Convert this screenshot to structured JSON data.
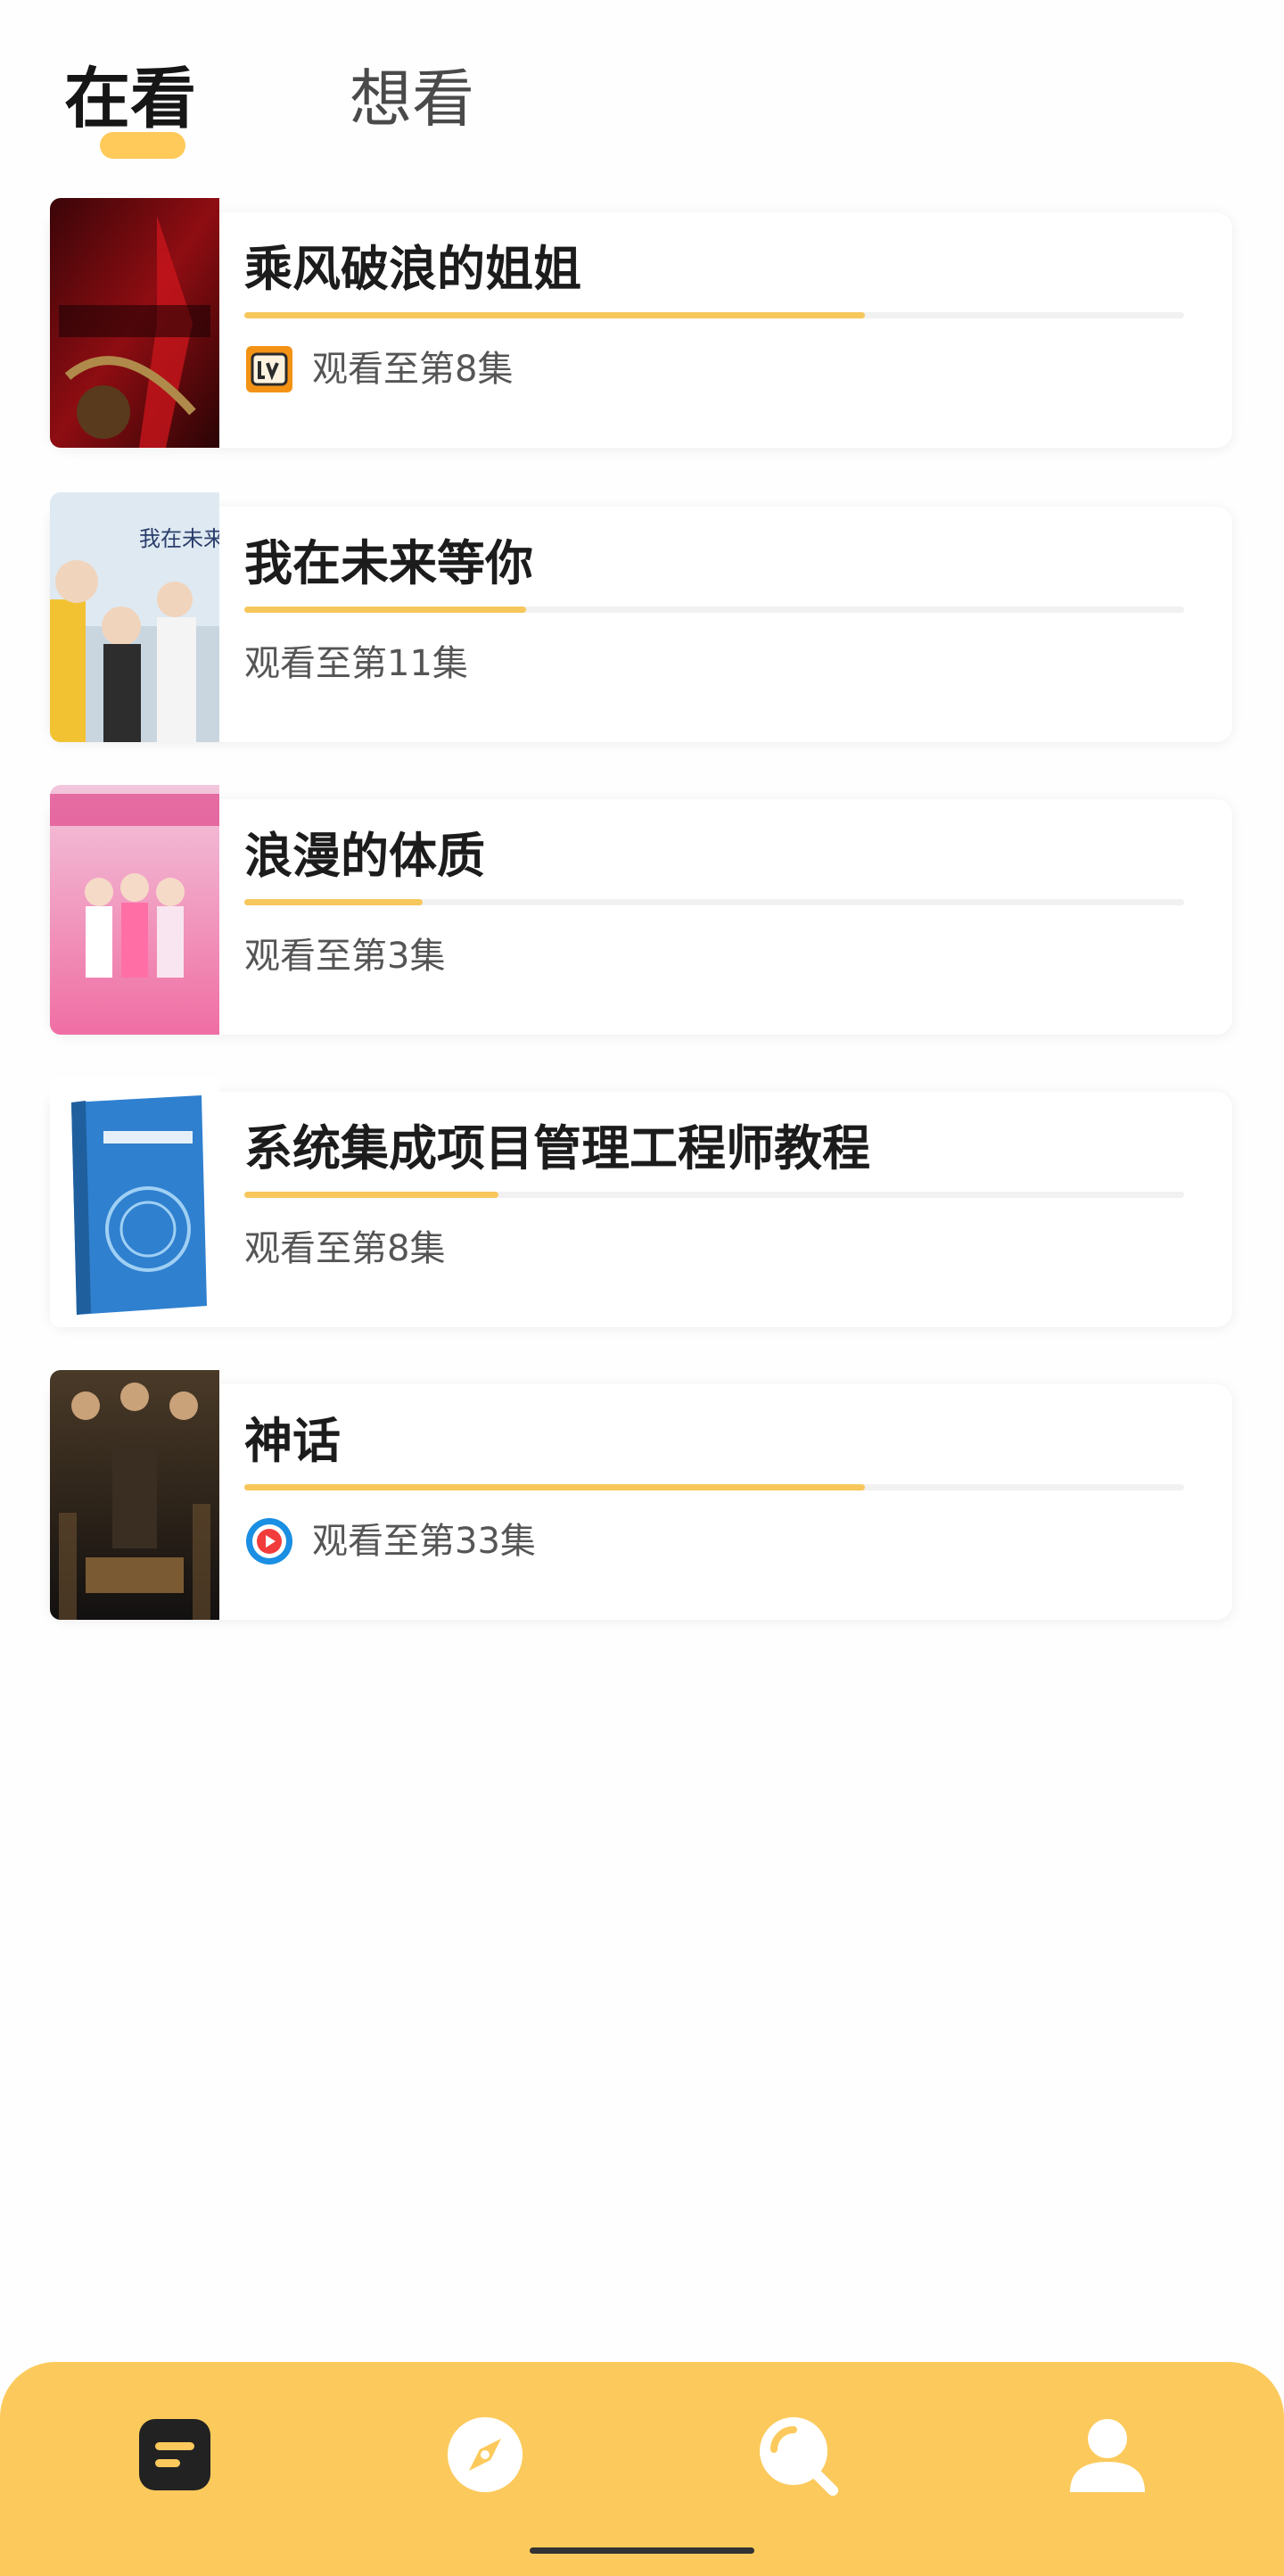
{
  "tabs": {
    "watching": "在看",
    "want_to_watch": "想看"
  },
  "items": [
    {
      "title": "乘风破浪的姐姐",
      "episode": "观看至第8集",
      "platform": "mango-tv-icon",
      "progress": 0.66
    },
    {
      "title": "我在未来等你",
      "episode": "观看至第11集",
      "platform": "",
      "progress": 0.3
    },
    {
      "title": "浪漫的体质",
      "episode": "观看至第3集",
      "platform": "",
      "progress": 0.19
    },
    {
      "title": "系统集成项目管理工程师教程",
      "episode": "观看至第8集",
      "platform": "",
      "progress": 0.27
    },
    {
      "title": "神话",
      "episode": "观看至第33集",
      "platform": "youku-icon",
      "progress": 0.66
    }
  ],
  "nav": {
    "items": [
      "list-icon",
      "compass-icon",
      "search-icon",
      "profile-icon"
    ]
  },
  "colors": {
    "accent": "#fcca5c",
    "progress": "#f7c75c",
    "active_icon": "#222222",
    "inactive_icon": "#ffffff"
  }
}
